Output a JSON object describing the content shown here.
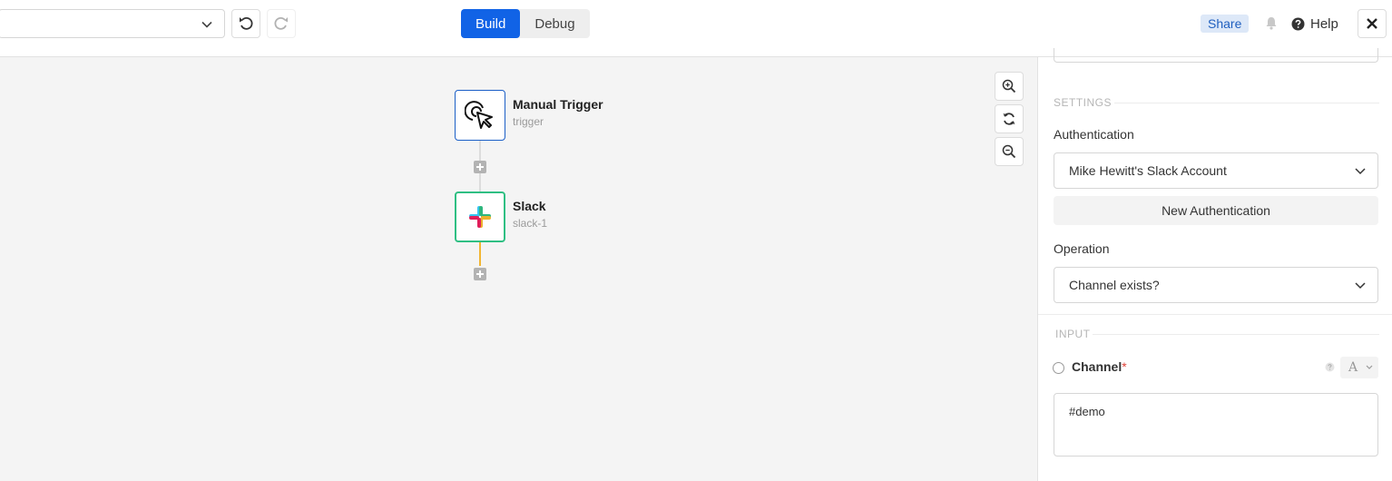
{
  "header": {
    "workflow_select_value": "",
    "modes": [
      {
        "label": "Build",
        "active": true
      },
      {
        "label": "Debug",
        "active": false
      }
    ],
    "share_label": "Share",
    "help_label": "Help"
  },
  "canvas": {
    "nodes": [
      {
        "title": "Manual Trigger",
        "subtitle": "trigger",
        "icon": "cursor-click-icon"
      },
      {
        "title": "Slack",
        "subtitle": "slack-1",
        "icon": "slack-logo-icon"
      }
    ],
    "zoom_controls": [
      "zoom-in-icon",
      "reset-icon",
      "zoom-out-icon"
    ]
  },
  "panel": {
    "settings_label": "SETTINGS",
    "authentication_label": "Authentication",
    "authentication_value": "Mike Hewitt's Slack Account",
    "new_authentication_label": "New Authentication",
    "operation_label": "Operation",
    "operation_value": "Channel exists?",
    "input_label": "INPUT",
    "channel_label": "Channel",
    "channel_required_mark": "*",
    "channel_type": "A",
    "channel_value": "#demo"
  },
  "colors": {
    "primary": "#1163e6",
    "slack_node_border": "#2fbf83",
    "connector_active": "#f2b632",
    "required": "#e0443b"
  }
}
